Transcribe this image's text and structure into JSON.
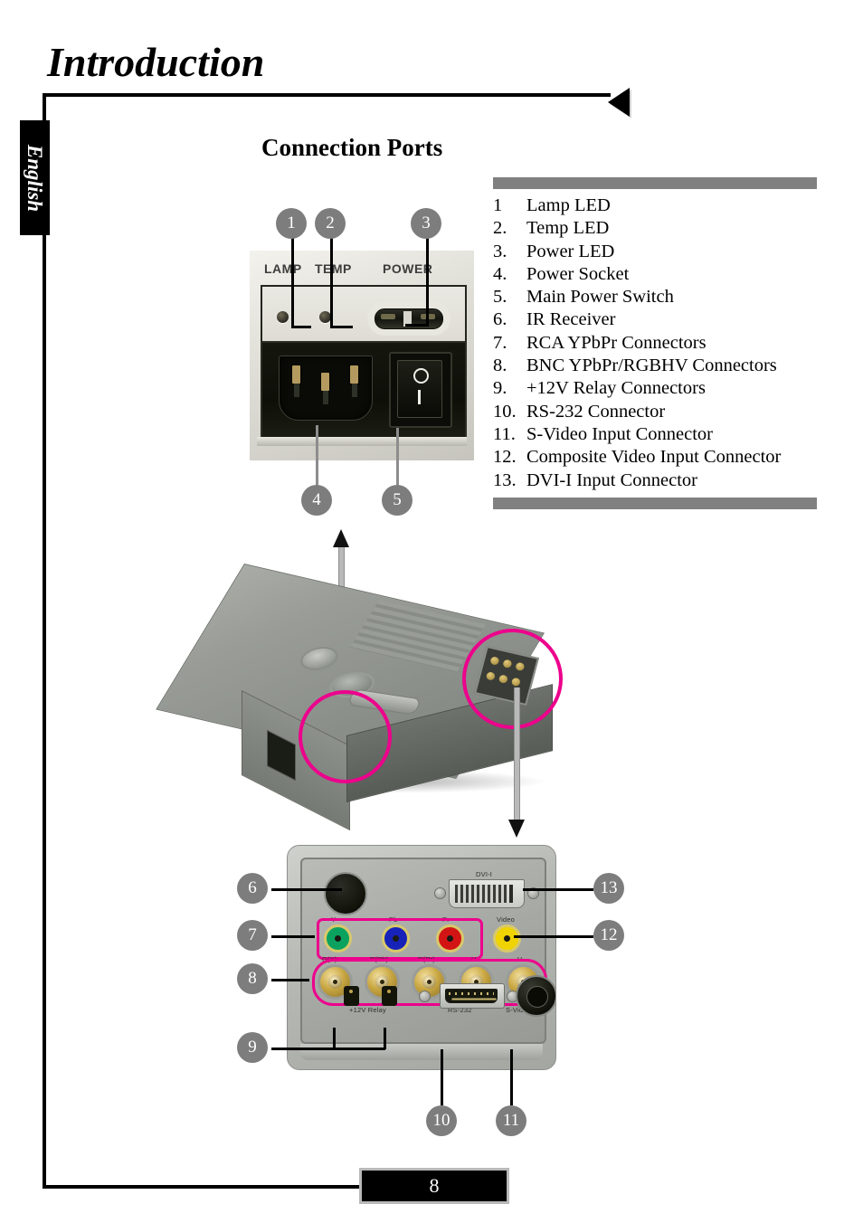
{
  "document": {
    "title": "Introduction",
    "language_tab": "English",
    "page_number": "8"
  },
  "section": {
    "heading": "Connection Ports"
  },
  "legend": {
    "items": [
      {
        "num": "1",
        "label": "Lamp LED"
      },
      {
        "num": "2.",
        "label": "Temp LED"
      },
      {
        "num": "3.",
        "label": "Power LED"
      },
      {
        "num": "4.",
        "label": "Power  Socket"
      },
      {
        "num": "5.",
        "label": "Main Power  Switch"
      },
      {
        "num": "6.",
        "label": "IR Receiver"
      },
      {
        "num": "7.",
        "label": "RCA YPbPr Connectors"
      },
      {
        "num": "8.",
        "label": "BNC YPbPr/RGBHV Connectors"
      },
      {
        "num": "9.",
        "label": "+12V Relay Connectors"
      },
      {
        "num": "10.",
        "label": "RS-232  Connector"
      },
      {
        "num": "11.",
        "label": "S-Video Input Connector"
      },
      {
        "num": "12.",
        "label": "Composite Video  Input Connector"
      },
      {
        "num": "13.",
        "label": "DVI-I Input Connector"
      }
    ]
  },
  "led_panel_photo": {
    "labels": {
      "lamp": "LAMP",
      "temp": "TEMP",
      "power": "POWER"
    },
    "switch_marks": {
      "off": "O",
      "on": "I"
    },
    "callouts": [
      "1",
      "2",
      "3",
      "4",
      "5"
    ]
  },
  "connector_panel_photo": {
    "labels": {
      "dvi": "DVI-I",
      "rca_y": "Y",
      "rca_pb": "Pb",
      "rca_pr": "Pr",
      "video": "Video",
      "bnc_g": "G(Y)",
      "bnc_b": "B(Pb)",
      "bnc_r": "R(Pr)",
      "bnc_h": "H",
      "bnc_v": "V",
      "relay": "+12V Relay",
      "rs232": "RS-232",
      "svideo": "S-Video"
    },
    "callouts": [
      "6",
      "7",
      "8",
      "9",
      "10",
      "11",
      "12",
      "13"
    ]
  },
  "colors": {
    "accent_highlight": "#ec008c",
    "callout_badge": "#7d7d7d",
    "legend_bar": "#808080",
    "rca_y": "#0aa25e",
    "rca_pb": "#1723b8",
    "rca_pr": "#d31414",
    "video": "#f0d302"
  }
}
